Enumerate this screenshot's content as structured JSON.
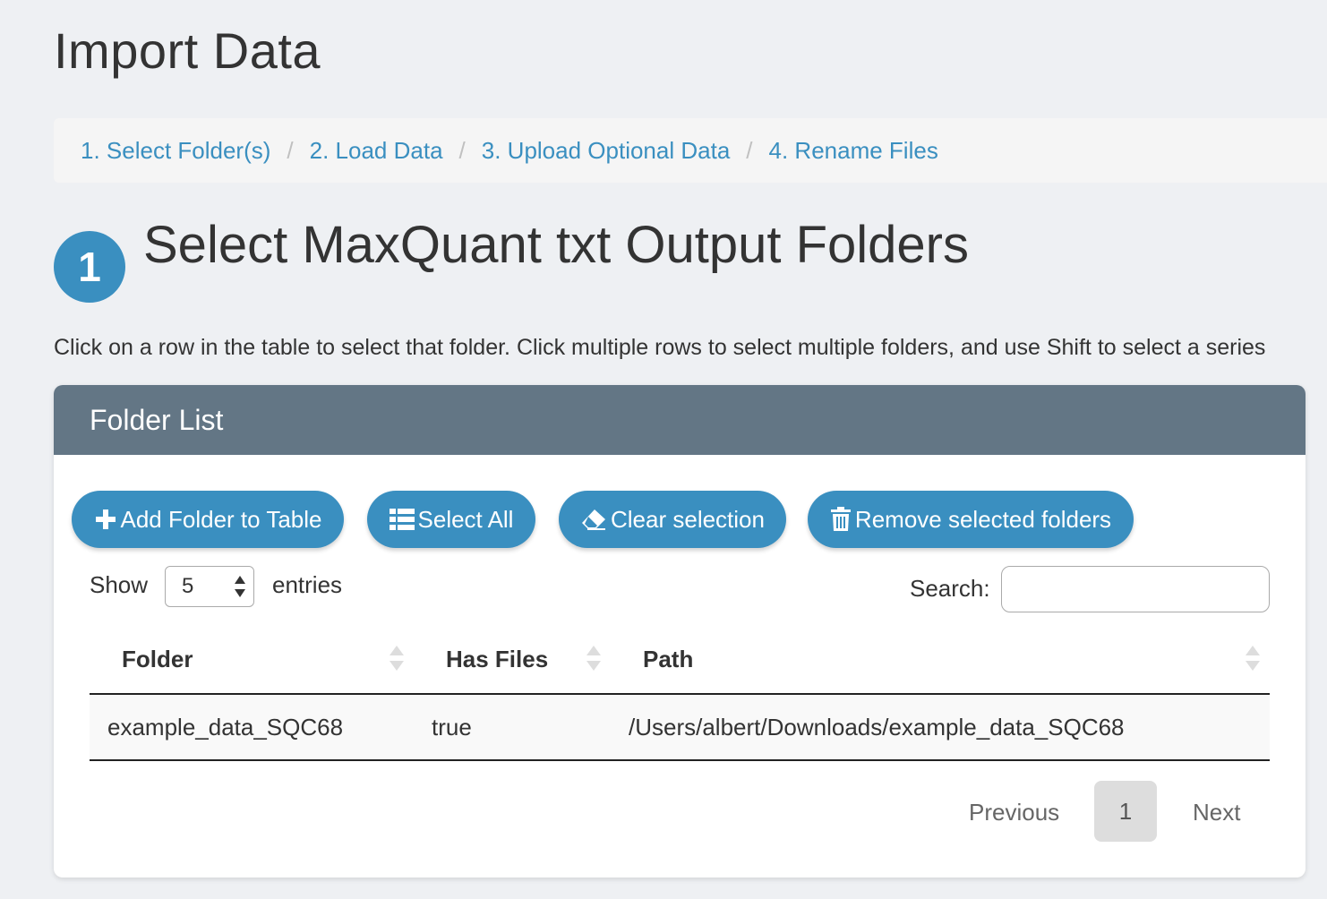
{
  "page": {
    "title": "Import Data"
  },
  "breadcrumb": {
    "items": [
      "1. Select Folder(s)",
      "2. Load Data",
      "3. Upload Optional Data",
      "4. Rename Files"
    ],
    "separator": "/"
  },
  "step": {
    "number": "1",
    "title": "Select MaxQuant txt Output Folders",
    "instructions": "Click on a row in the table to select that folder. Click multiple rows to select multiple folders, and use Shift to select a series"
  },
  "panel": {
    "title": "Folder List",
    "buttons": {
      "add": "Add Folder to Table",
      "select_all": "Select All",
      "clear": "Clear selection",
      "remove": "Remove selected folders"
    },
    "icons": {
      "add": "plus-icon",
      "select_all": "list-icon",
      "clear": "eraser-icon",
      "remove": "trash-icon"
    }
  },
  "table_controls": {
    "show_label": "Show",
    "entries_value": "5",
    "entries_label": "entries",
    "search_label": "Search:",
    "search_value": ""
  },
  "table": {
    "columns": [
      "Folder",
      "Has Files",
      "Path"
    ],
    "rows": [
      {
        "folder": "example_data_SQC68",
        "has_files": "true",
        "path": "/Users/albert/Downloads/example_data_SQC68"
      }
    ]
  },
  "pagination": {
    "previous": "Previous",
    "current": "1",
    "next": "Next"
  },
  "colors": {
    "accent": "#3a8fc0",
    "panel_header": "#637685",
    "background": "#eef0f3"
  }
}
